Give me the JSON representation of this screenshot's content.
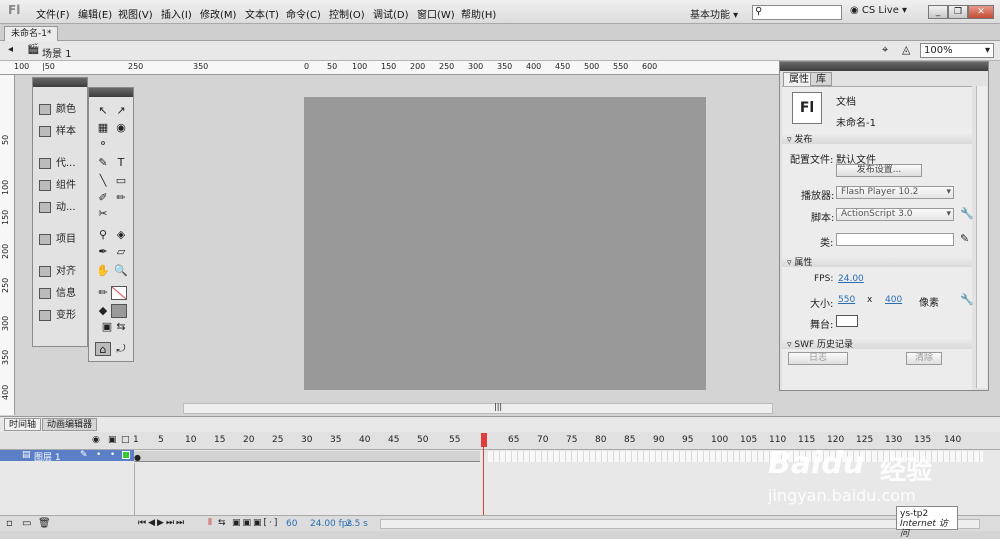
{
  "app": {
    "logo": "Fl",
    "workspace": "基本功能",
    "cs_live": "CS Live",
    "win_buttons": [
      "_",
      "❐",
      "✕"
    ]
  },
  "menu": [
    "文件(F)",
    "编辑(E)",
    "视图(V)",
    "插入(I)",
    "修改(M)",
    "文本(T)",
    "命令(C)",
    "控制(O)",
    "调试(D)",
    "窗口(W)",
    "帮助(H)"
  ],
  "doc": {
    "tab": "未命名-1*",
    "scene": "场景 1",
    "zoom": "100%"
  },
  "ruler": {
    "h_ticks": [
      "100",
      "|50",
      "200",
      "250",
      "300",
      "350",
      "100",
      "150",
      "100",
      "150",
      "0",
      "50",
      "100",
      "150",
      "200",
      "250",
      "300",
      "350",
      "400",
      "450",
      "500",
      "550",
      "600"
    ],
    "v_ticks": [
      "50",
      "100",
      "150",
      "200",
      "250",
      "300",
      "350",
      "400"
    ]
  },
  "side_panel": {
    "items": [
      {
        "icon": "palette-icon",
        "label": "颜色"
      },
      {
        "icon": "swatches-icon",
        "label": "样本"
      },
      {
        "icon": "code-icon",
        "label": "代..."
      },
      {
        "icon": "components-icon",
        "label": "组件"
      },
      {
        "icon": "motion-icon",
        "label": "动..."
      },
      {
        "icon": "project-icon",
        "label": "项目"
      },
      {
        "icon": "align-icon",
        "label": "对齐"
      },
      {
        "icon": "info-icon",
        "label": "信息"
      },
      {
        "icon": "transform-icon",
        "label": "变形"
      }
    ]
  },
  "tools": [
    "↖",
    "↗",
    "▦",
    "◉",
    "⚬",
    "",
    "✎",
    "T",
    "╲",
    "▭",
    "✐",
    "✏",
    "✂",
    "",
    "⚲",
    "◈",
    "✒",
    "▱",
    "✋",
    "🔍",
    "✏",
    "⧄",
    "◆",
    "▣",
    "⊞",
    "⇆",
    "⌂",
    "⤾"
  ],
  "properties": {
    "tabs": [
      "属性",
      "库"
    ],
    "doc_icon": "Fl",
    "doc_type": "文档",
    "doc_name": "未命名-1",
    "sections": {
      "publish": "发布",
      "props": "属性",
      "swf": "SWF 历史记录"
    },
    "profile_label": "配置文件:",
    "profile_value": "默认文件",
    "publish_settings": "发布设置...",
    "player_label": "播放器:",
    "player_value": "Flash Player 10.2",
    "script_label": "脚本:",
    "script_value": "ActionScript 3.0",
    "class_label": "类:",
    "fps_label": "FPS:",
    "fps_value": "24.00",
    "size_label": "大小:",
    "width": "550",
    "x": "x",
    "height": "400",
    "unit": "像素",
    "stage_label": "舞台:",
    "log_button": "日志",
    "clear_button": "清除"
  },
  "timeline": {
    "tabs": [
      "时间轴",
      "动画编辑器"
    ],
    "frame_numbers": [
      "1",
      "5",
      "10",
      "15",
      "20",
      "25",
      "30",
      "35",
      "40",
      "45",
      "50",
      "55",
      "60",
      "65",
      "70",
      "75",
      "80",
      "85",
      "90",
      "95",
      "100",
      "105",
      "110",
      "115",
      "120",
      "125",
      "130",
      "135",
      "140"
    ],
    "layer_name": "图层 1",
    "current_frame": "60",
    "fps": "24.00 fps",
    "time": "2.5 s"
  },
  "watermark": {
    "brand": "Baidu",
    "brand_cn": "经验",
    "url": "jingyan.baidu.com"
  },
  "tooltip": {
    "line1": "ys-tp2",
    "line2": "Internet 访问"
  },
  "colors": {
    "stage": "#999999",
    "layer": "#5b7fc7",
    "playhead": "#e03c3c",
    "link": "#2a6fb6"
  }
}
